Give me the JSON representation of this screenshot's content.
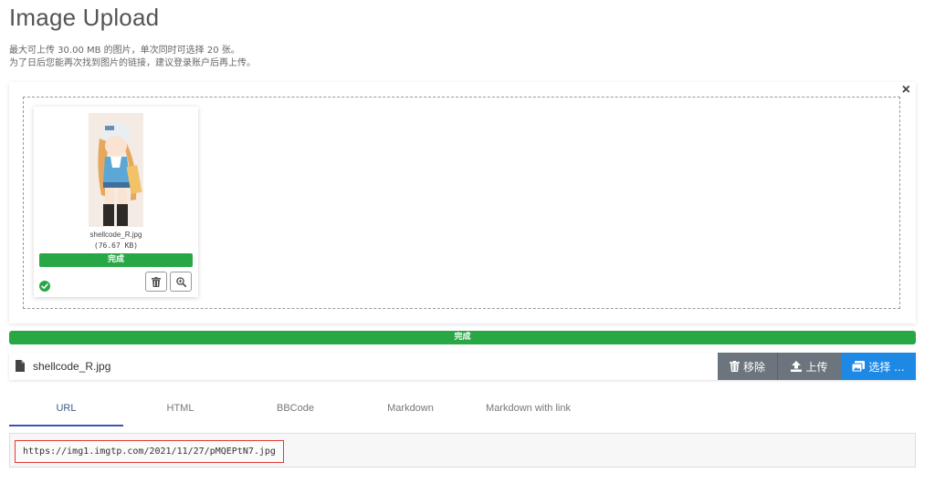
{
  "header": {
    "title": "Image Upload",
    "desc_line1": "最大可上传 30.00 MB 的图片，单次同时可选择 20 张。",
    "desc_line2": "为了日后您能再次找到图片的链接，建议登录账户后再上传。"
  },
  "dropzone": {
    "close_label": "×",
    "thumbnail": {
      "file_name": "shellcode_R.jpg",
      "file_size": "(76.67 KB)",
      "progress_label": "完成",
      "progress": 100,
      "status_icon": "check-circle-icon",
      "delete_icon": "trash-icon",
      "zoom_icon": "zoom-in-icon"
    }
  },
  "main_progress": {
    "label": "完成",
    "progress": 100
  },
  "file_bar": {
    "file_icon": "file-icon",
    "file_name": "shellcode_R.jpg",
    "remove_label": "移除",
    "upload_label": "上传",
    "choose_label": "选择 ..."
  },
  "tabs": [
    {
      "label": "URL",
      "active": true
    },
    {
      "label": "HTML",
      "active": false
    },
    {
      "label": "BBCode",
      "active": false
    },
    {
      "label": "Markdown",
      "active": false
    },
    {
      "label": "Markdown with link",
      "active": false
    }
  ],
  "output": {
    "url": "https://img1.imgtp.com/2021/11/27/pMQEPtN7.jpg"
  },
  "colors": {
    "success": "#28a745",
    "primary": "#1e88e5",
    "secondary": "#6c757d",
    "highlight_border": "#e53935",
    "tab_underline": "#3f51b5"
  }
}
